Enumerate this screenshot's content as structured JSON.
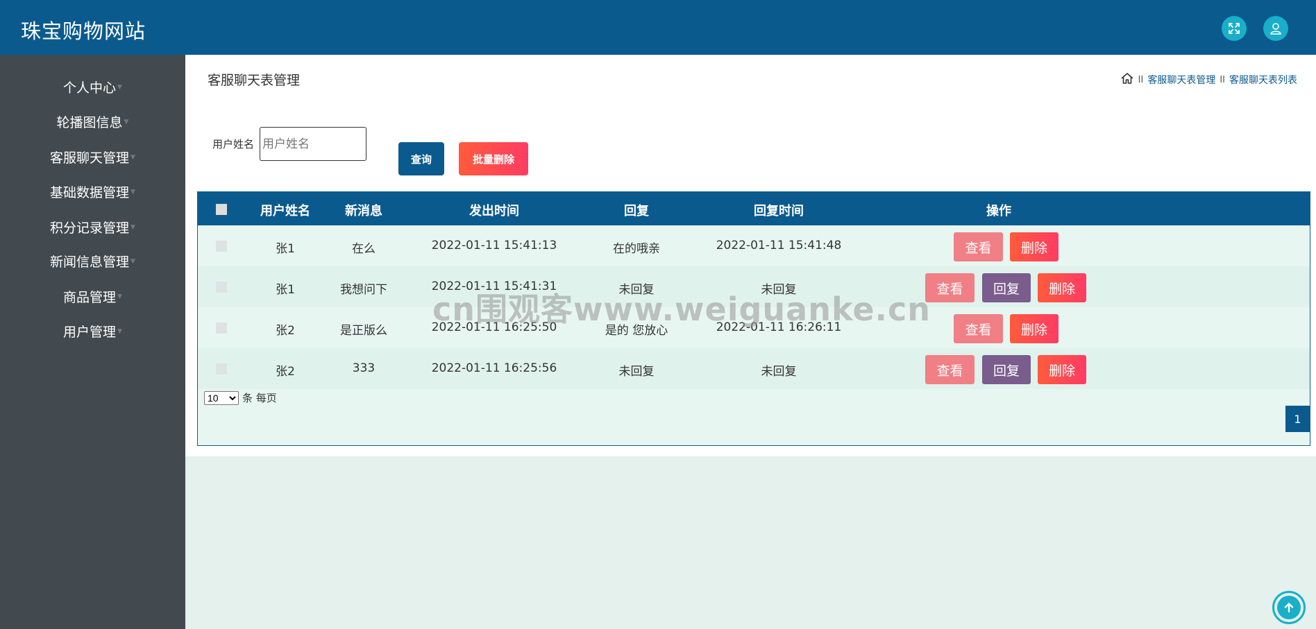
{
  "header": {
    "app_title": "珠宝购物网站",
    "icons": [
      "fullscreen-icon",
      "user-icon"
    ]
  },
  "sidebar": {
    "items": [
      {
        "label": "个人中心"
      },
      {
        "label": "轮播图信息"
      },
      {
        "label": "客服聊天管理"
      },
      {
        "label": "基础数据管理"
      },
      {
        "label": "积分记录管理"
      },
      {
        "label": "新闻信息管理"
      },
      {
        "label": "商品管理"
      },
      {
        "label": "用户管理"
      }
    ]
  },
  "page": {
    "title": "客服聊天表管理",
    "breadcrumb": {
      "home_icon": "home-icon",
      "separator": "II",
      "items": [
        "客服聊天表管理",
        "客服聊天表列表"
      ]
    }
  },
  "search": {
    "label": "用户姓名",
    "placeholder": "用户姓名",
    "value": "",
    "query_label": "查询",
    "batch_delete_label": "批量删除"
  },
  "table": {
    "columns": [
      "用户姓名",
      "新消息",
      "发出时间",
      "回复",
      "回复时间",
      "操作"
    ],
    "rows": [
      {
        "user": "张1",
        "message": "在么",
        "sent_time": "2022-01-11 15:41:13",
        "reply": "在的哦亲",
        "reply_time": "2022-01-11 15:41:48",
        "has_reply_button": false
      },
      {
        "user": "张1",
        "message": "我想问下",
        "sent_time": "2022-01-11 15:41:31",
        "reply": "未回复",
        "reply_time": "未回复",
        "has_reply_button": true
      },
      {
        "user": "张2",
        "message": "是正版么",
        "sent_time": "2022-01-11 16:25:50",
        "reply": "是的 您放心",
        "reply_time": "2022-01-11 16:26:11",
        "has_reply_button": false
      },
      {
        "user": "张2",
        "message": "333",
        "sent_time": "2022-01-11 16:25:56",
        "reply": "未回复",
        "reply_time": "未回复",
        "has_reply_button": true
      }
    ],
    "actions": {
      "view": "查看",
      "reply": "回复",
      "delete": "删除"
    }
  },
  "pagination": {
    "page_size": "10",
    "page_size_options": [
      "10"
    ],
    "per_page_suffix": "条 每页",
    "current_page": "1"
  },
  "watermark": "cn围观客www.weiguanke.cn",
  "colors": {
    "primary": "#0b5a8e",
    "sidebar": "#434a4f",
    "accent": "#19aec9",
    "view": "#f07f86",
    "reply": "#7a5c8d",
    "delete": "#ff4650"
  }
}
